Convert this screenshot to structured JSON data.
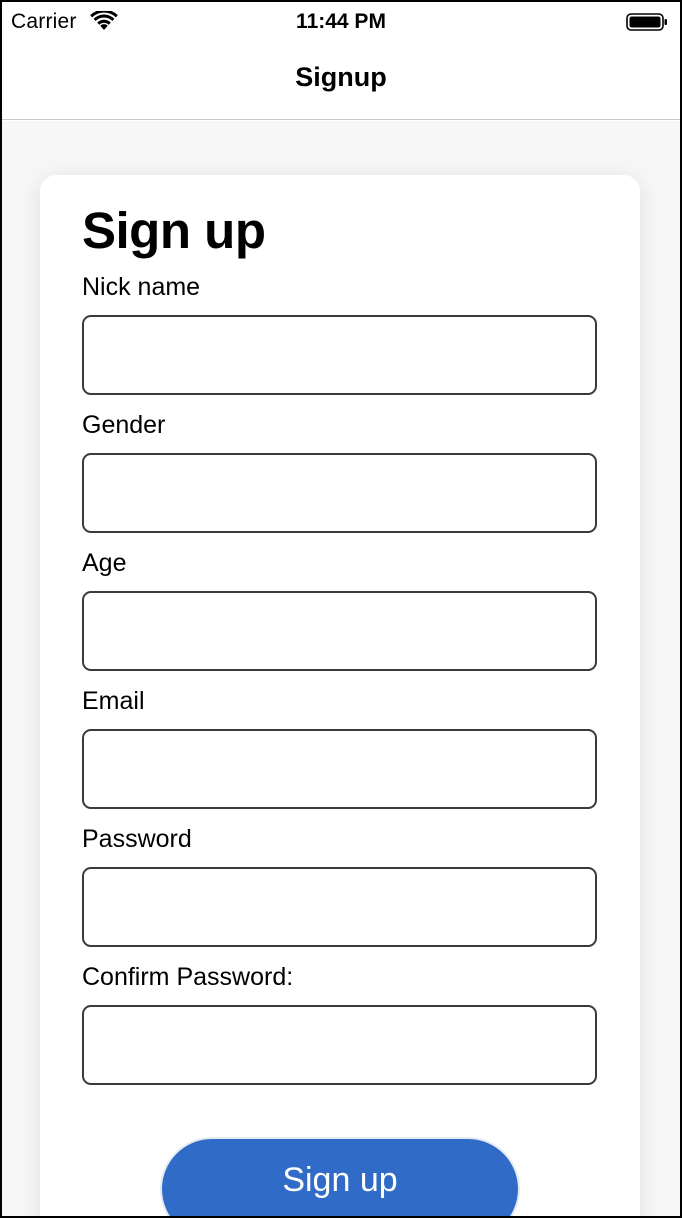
{
  "status_bar": {
    "carrier": "Carrier",
    "time": "11:44 PM",
    "wifi_icon": "wifi-icon",
    "battery_icon": "battery-icon"
  },
  "nav": {
    "title": "Signup"
  },
  "form": {
    "title": "Sign up",
    "fields": [
      {
        "label": "Nick name",
        "value": "",
        "placeholder": ""
      },
      {
        "label": "Gender",
        "value": "",
        "placeholder": ""
      },
      {
        "label": "Age",
        "value": "",
        "placeholder": ""
      },
      {
        "label": "Email",
        "value": "",
        "placeholder": ""
      },
      {
        "label": "Password",
        "value": "",
        "placeholder": ""
      },
      {
        "label": "Confirm Password:",
        "value": "",
        "placeholder": ""
      }
    ],
    "submit_label": "Sign up"
  },
  "colors": {
    "accent": "#2f6bc7",
    "input_border": "#3a3a3c",
    "nav_divider": "#c7c7cc"
  }
}
